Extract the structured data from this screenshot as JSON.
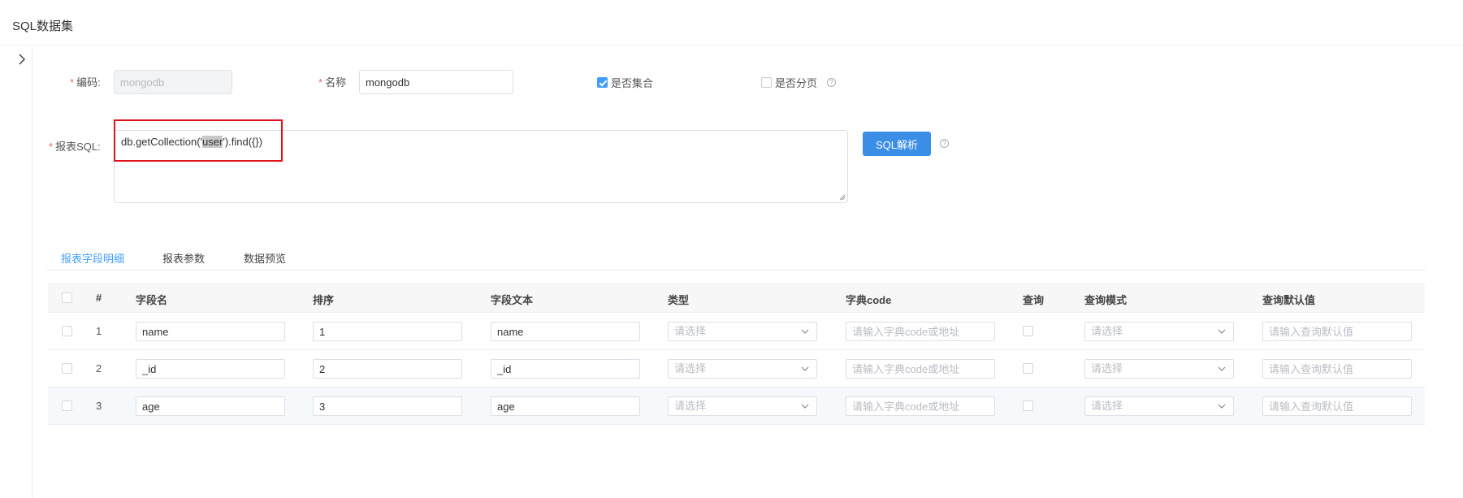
{
  "page": {
    "title": "SQL数据集"
  },
  "form": {
    "code": {
      "label": "编码:",
      "value": "mongodb"
    },
    "name": {
      "label": "名称",
      "value": "mongodb"
    },
    "is_collection": {
      "label": "是否集合",
      "checked": true
    },
    "is_paged": {
      "label": "是否分页",
      "checked": false
    },
    "sql": {
      "label": "报表SQL:",
      "prefix": "db.getCollection('",
      "highlight": "user",
      "suffix": "').find({})"
    },
    "parse_button": "SQL解析"
  },
  "tabs": [
    {
      "label": "报表字段明细",
      "active": true
    },
    {
      "label": "报表参数",
      "active": false
    },
    {
      "label": "数据预览",
      "active": false
    }
  ],
  "table": {
    "headers": [
      "#",
      "字段名",
      "排序",
      "字段文本",
      "类型",
      "字典code",
      "查询",
      "查询模式",
      "查询默认值"
    ],
    "placeholders": {
      "type": "请选择",
      "dict": "请输入字典code或地址",
      "mode": "请选择",
      "default": "请输入查询默认值"
    },
    "rows": [
      {
        "index": "1",
        "field": "name",
        "order": "1",
        "text": "name"
      },
      {
        "index": "2",
        "field": "_id",
        "order": "2",
        "text": "_id"
      },
      {
        "index": "3",
        "field": "age",
        "order": "3",
        "text": "age"
      }
    ]
  },
  "colors": {
    "primary": "#409eff",
    "required": "#f56c6c",
    "annotation": "#e3121a"
  },
  "icons": {
    "collapse": "chevron-right-icon",
    "help": "question-circle-icon",
    "dropdown": "chevron-down-icon"
  }
}
